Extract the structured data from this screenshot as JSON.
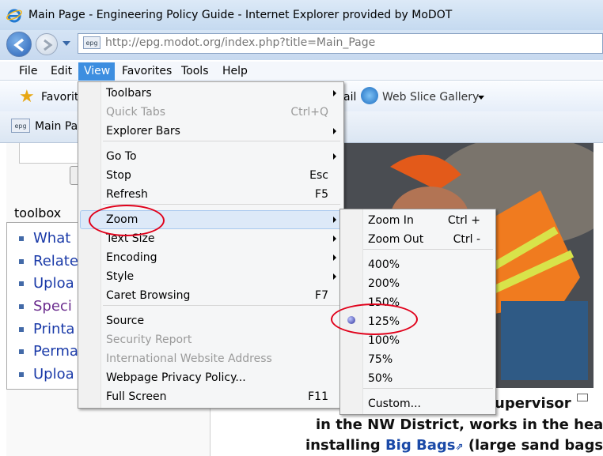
{
  "window": {
    "title": "Main Page - Engineering Policy Guide - Internet Explorer provided by MoDOT"
  },
  "address": {
    "url": "http://epg.modot.org/index.php?title=Main_Page"
  },
  "menubar": {
    "items": [
      "File",
      "Edit",
      "View",
      "Favorites",
      "Tools",
      "Help"
    ]
  },
  "favorites_bar": {
    "favorites_label": "Favorit",
    "mail_label": "ail",
    "web_slice_label": "Web Slice Gallery"
  },
  "tab": {
    "label": "Main Pa"
  },
  "page": {
    "toolbox_title": "toolbox",
    "toolbox_items": [
      "What",
      "Relate",
      "Uploa",
      "Speci",
      "Printa",
      "Perma",
      "Uploa"
    ],
    "caption_lines": [
      "upervisor",
      "in the NW District, works in the heat",
      "installing",
      "Big Bags",
      "(large sand bags"
    ]
  },
  "view_menu": {
    "items": [
      {
        "label": "Toolbars",
        "shortcut": "",
        "submenu": true,
        "disabled": false
      },
      {
        "label": "Quick Tabs",
        "shortcut": "Ctrl+Q",
        "submenu": false,
        "disabled": true
      },
      {
        "label": "Explorer Bars",
        "shortcut": "",
        "submenu": true,
        "disabled": false
      },
      {
        "label": "Go To",
        "shortcut": "",
        "submenu": true,
        "disabled": false
      },
      {
        "label": "Stop",
        "shortcut": "Esc",
        "submenu": false,
        "disabled": false
      },
      {
        "label": "Refresh",
        "shortcut": "F5",
        "submenu": false,
        "disabled": false
      },
      {
        "label": "Zoom",
        "shortcut": "",
        "submenu": true,
        "disabled": false
      },
      {
        "label": "Text Size",
        "shortcut": "",
        "submenu": true,
        "disabled": false
      },
      {
        "label": "Encoding",
        "shortcut": "",
        "submenu": true,
        "disabled": false
      },
      {
        "label": "Style",
        "shortcut": "",
        "submenu": true,
        "disabled": false
      },
      {
        "label": "Caret Browsing",
        "shortcut": "F7",
        "submenu": false,
        "disabled": false
      },
      {
        "label": "Source",
        "shortcut": "",
        "submenu": false,
        "disabled": false
      },
      {
        "label": "Security Report",
        "shortcut": "",
        "submenu": false,
        "disabled": true
      },
      {
        "label": "International Website Address",
        "shortcut": "",
        "submenu": false,
        "disabled": true
      },
      {
        "label": "Webpage Privacy Policy...",
        "shortcut": "",
        "submenu": false,
        "disabled": false
      },
      {
        "label": "Full Screen",
        "shortcut": "F11",
        "submenu": false,
        "disabled": false
      }
    ]
  },
  "zoom_menu": {
    "items": [
      {
        "label": "Zoom In",
        "shortcut": "Ctrl +"
      },
      {
        "label": "Zoom Out",
        "shortcut": "Ctrl -"
      },
      {
        "label": "400%",
        "shortcut": ""
      },
      {
        "label": "200%",
        "shortcut": ""
      },
      {
        "label": "150%",
        "shortcut": ""
      },
      {
        "label": "125%",
        "shortcut": "",
        "selected": true
      },
      {
        "label": "100%",
        "shortcut": ""
      },
      {
        "label": "75%",
        "shortcut": ""
      },
      {
        "label": "50%",
        "shortcut": ""
      },
      {
        "label": "Custom...",
        "shortcut": ""
      }
    ]
  },
  "colors": {
    "annotation_red": "#e0001a",
    "menu_highlight": "#3d8ee0",
    "link_blue": "#1a3aa8"
  },
  "icons": [
    "ie-logo-icon",
    "back-icon",
    "forward-icon",
    "star-icon",
    "web-slice-icon",
    "radio-selected-icon",
    "resize-icon"
  ]
}
